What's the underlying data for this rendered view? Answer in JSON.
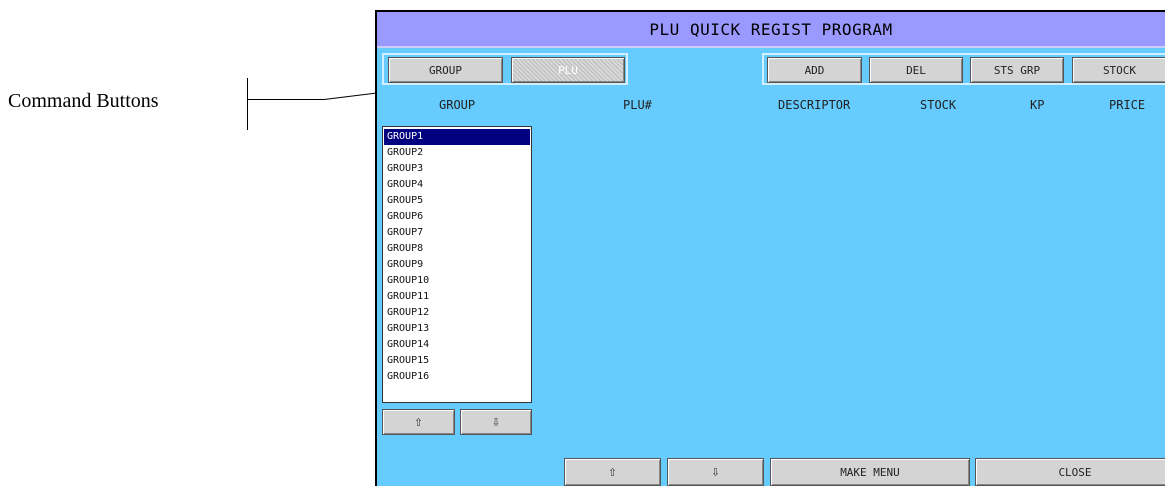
{
  "annotation": {
    "label": "Command Buttons"
  },
  "window": {
    "title": "PLU QUICK REGIST PROGRAM"
  },
  "toggle": {
    "group_label": "GROUP",
    "plu_label": "PLU"
  },
  "commands": {
    "add": "ADD",
    "del": "DEL",
    "sts_grp": "STS GRP",
    "stock": "STOCK"
  },
  "columns": {
    "group": "GROUP",
    "plu": "PLU#",
    "descriptor": "DESCRIPTOR",
    "stock": "STOCK",
    "kp": "KP",
    "price": "PRICE"
  },
  "groups": [
    "GROUP1",
    "GROUP2",
    "GROUP3",
    "GROUP4",
    "GROUP5",
    "GROUP6",
    "GROUP7",
    "GROUP8",
    "GROUP9",
    "GROUP10",
    "GROUP11",
    "GROUP12",
    "GROUP13",
    "GROUP14",
    "GROUP15",
    "GROUP16"
  ],
  "selected_group": "GROUP1",
  "footer": {
    "up": "⇧",
    "down": "⇩",
    "make_menu": "MAKE MENU",
    "close": "CLOSE"
  },
  "list_nav": {
    "up": "⇧",
    "down": "⇩"
  },
  "colors": {
    "screen_bg": "#66ccff",
    "title_bg": "#9999ff",
    "selection": "#000080"
  }
}
